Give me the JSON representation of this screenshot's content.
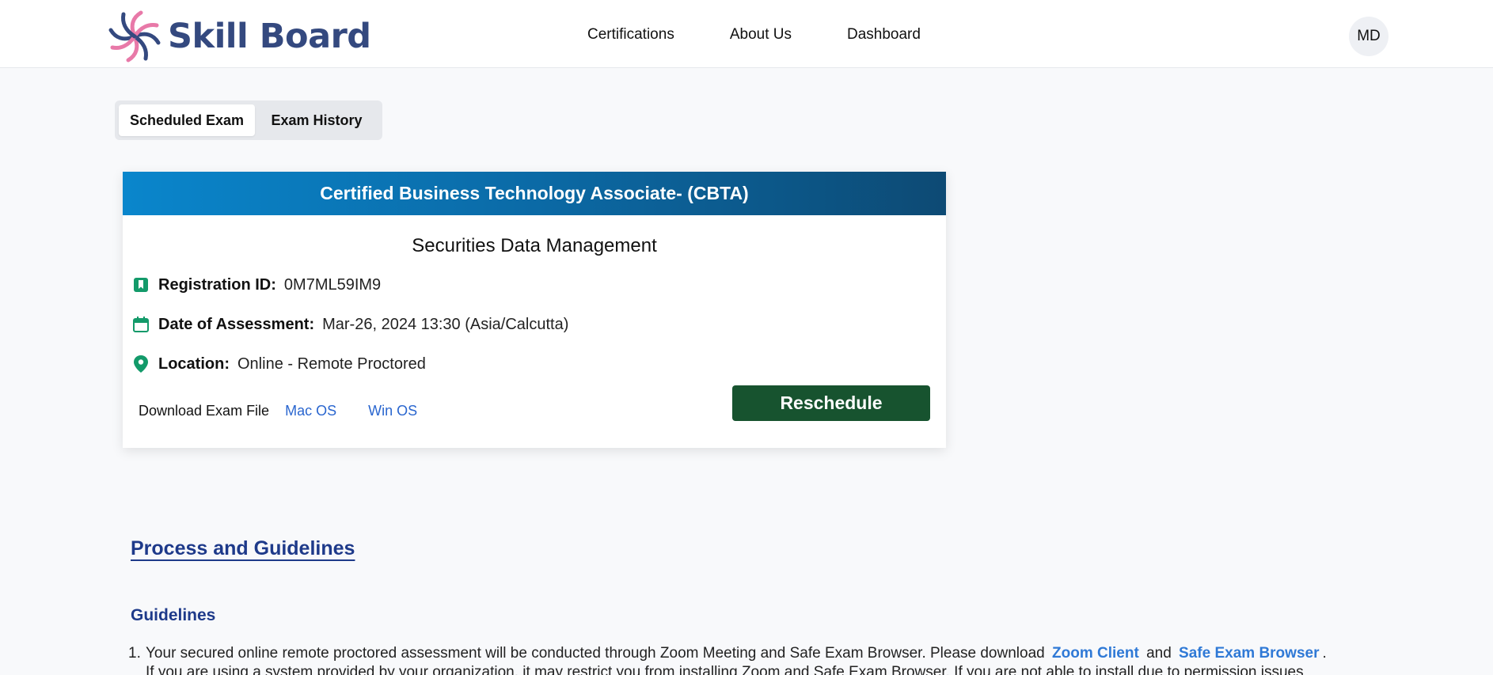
{
  "brand": {
    "name": "Skill Board",
    "colors": {
      "primary": "#34497f",
      "accent_pink": "#e879a8",
      "accent_green": "#17532f"
    }
  },
  "nav": {
    "items": [
      "Certifications",
      "About Us",
      "Dashboard"
    ]
  },
  "user": {
    "initials": "MD"
  },
  "tabs": {
    "scheduled": "Scheduled Exam",
    "history": "Exam History",
    "active": "Scheduled Exam"
  },
  "exam": {
    "certification": "Certified Business Technology Associate- (CBTA)",
    "subject": "Securities Data Management",
    "registration_label": "Registration ID:",
    "registration_id": "0M7ML59IM9",
    "date_label": "Date of Assessment:",
    "date_value": "Mar-26, 2024 13:30 (Asia/Calcutta)",
    "location_label": "Location:",
    "location_value": "Online - Remote Proctored",
    "download_label": "Download Exam File",
    "mac_link": "Mac OS",
    "win_link": "Win OS",
    "reschedule_label": "Reschedule",
    "icons": {
      "registration": "bookmark-icon",
      "date": "calendar-icon",
      "location": "map-pin-icon"
    }
  },
  "process": {
    "title": "Process and Guidelines",
    "guidelines_title": "Guidelines",
    "item1": {
      "number": "1.",
      "text_before": "Your secured online remote proctored assessment will be conducted through Zoom Meeting and Safe Exam Browser. Please download",
      "link1": "Zoom Client",
      "and": "and",
      "link2": "Safe Exam Browser",
      "period": ".",
      "line2": "If you are using a system provided by your organization, it may restrict you from installing Zoom and Safe Exam Browser. If you are not able to install due to permission issues"
    }
  }
}
